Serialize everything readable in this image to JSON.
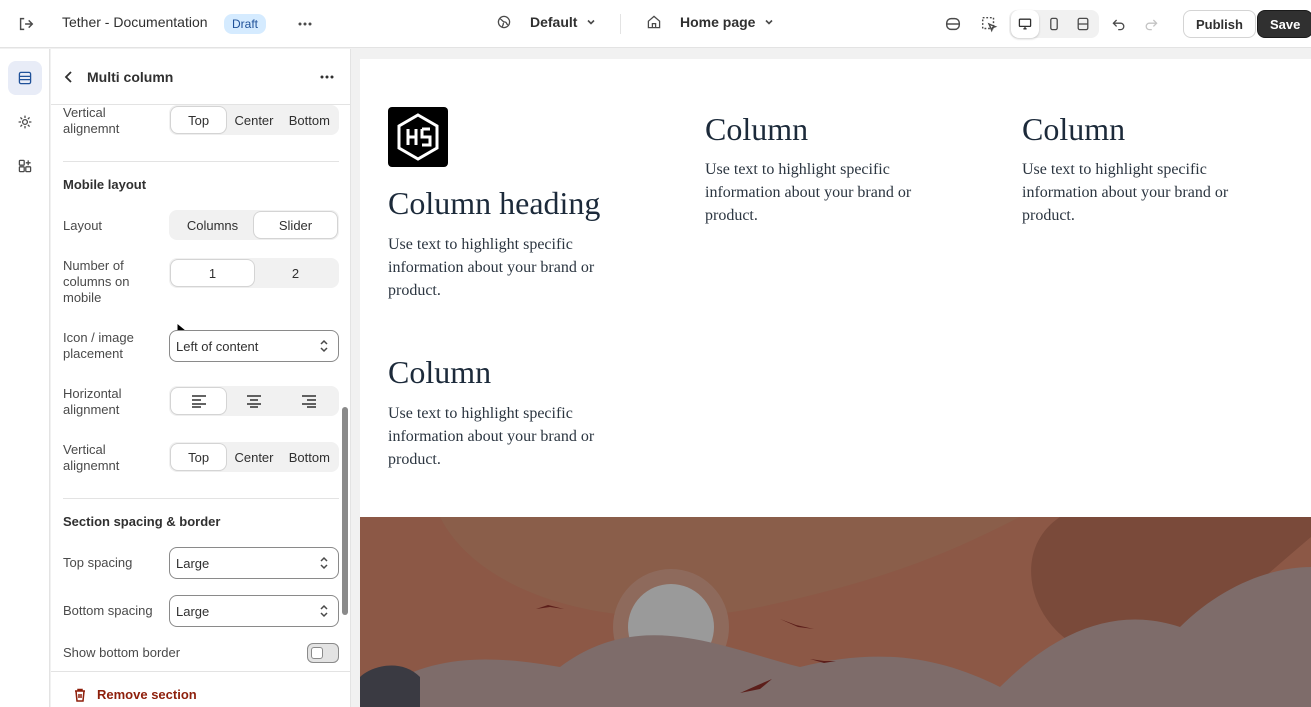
{
  "topbar": {
    "title": "Tether - Documentation",
    "badge": "Draft",
    "theme_selector": "Default",
    "page_selector": "Home page",
    "publish_label": "Publish",
    "save_label": "Save"
  },
  "panel": {
    "title": "Multi column",
    "vertical_alignment_top": {
      "label": "Vertical alignemnt",
      "options": [
        "Top",
        "Center",
        "Bottom"
      ],
      "selected": "Top"
    },
    "mobile_heading": "Mobile layout",
    "layout": {
      "label": "Layout",
      "options": [
        "Columns",
        "Slider"
      ],
      "selected": "Slider"
    },
    "columns_mobile": {
      "label": "Number of columns on mobile",
      "options": [
        "1",
        "2"
      ],
      "selected": "1"
    },
    "icon_placement": {
      "label": "Icon / image placement",
      "value": "Left of content"
    },
    "horizontal_alignment": {
      "label": "Horizontal alignment",
      "selected": "left"
    },
    "vertical_alignment_mobile": {
      "label": "Vertical alignemnt",
      "options": [
        "Top",
        "Center",
        "Bottom"
      ],
      "selected": "Top"
    },
    "spacing_heading": "Section spacing & border",
    "top_spacing": {
      "label": "Top spacing",
      "value": "Large"
    },
    "bottom_spacing": {
      "label": "Bottom spacing",
      "value": "Large"
    },
    "bottom_border": {
      "label": "Show bottom border",
      "on": false
    },
    "remove_label": "Remove section"
  },
  "preview": {
    "columns": [
      {
        "heading": "Column heading",
        "text": "Use text to highlight specific information about your brand or product."
      },
      {
        "heading": "Column",
        "text": "Use text to highlight specific information about your brand or product."
      },
      {
        "heading": "Column",
        "text": "Use text to highlight specific information about your brand or product."
      },
      {
        "heading": "Column",
        "text": "Use text to highlight specific information about your brand or product."
      }
    ]
  },
  "colors": {
    "accent": "#1f5199",
    "danger": "#8e1f0b",
    "dark_button": "#303030"
  }
}
